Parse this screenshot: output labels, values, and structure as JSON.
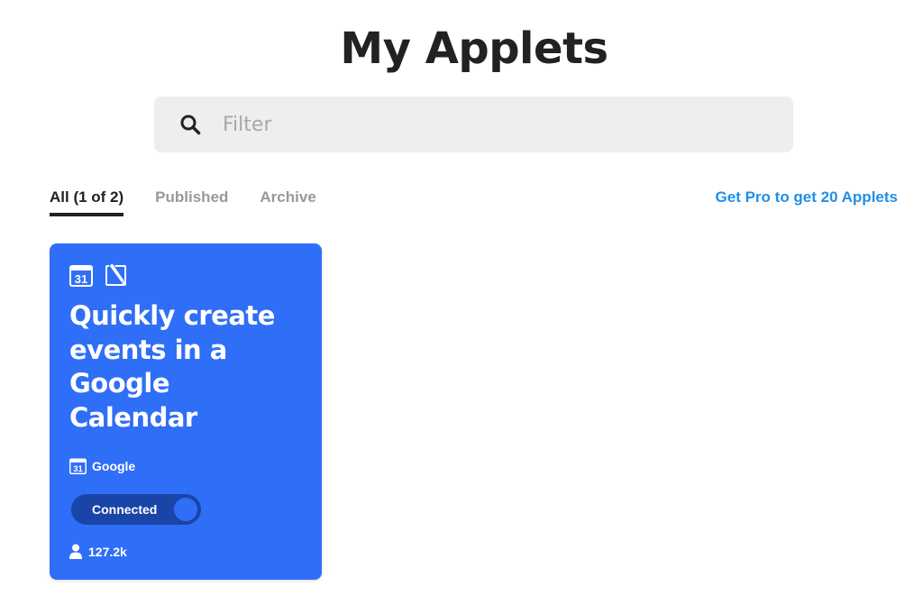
{
  "page": {
    "title": "My Applets"
  },
  "search": {
    "placeholder": "Filter",
    "value": ""
  },
  "tabs": [
    {
      "label": "All (1 of 2)",
      "active": true
    },
    {
      "label": "Published",
      "active": false
    },
    {
      "label": "Archive",
      "active": false
    }
  ],
  "pro_link": "Get Pro to get 20 Applets",
  "applets": [
    {
      "title": "Quickly create events in a Google Calendar",
      "service_icons": [
        "google-calendar-icon",
        "edit-note-icon"
      ],
      "owner": "Google",
      "owner_icon": "google-calendar-icon",
      "status": "Connected",
      "connected": true,
      "users": "127.2k",
      "color": "#2f6ef7"
    }
  ],
  "colors": {
    "accent_link": "#1f8fe8",
    "card_bg": "#2f6ef7",
    "toggle_bg": "#1a45a8",
    "search_bg": "#eeeeee"
  }
}
